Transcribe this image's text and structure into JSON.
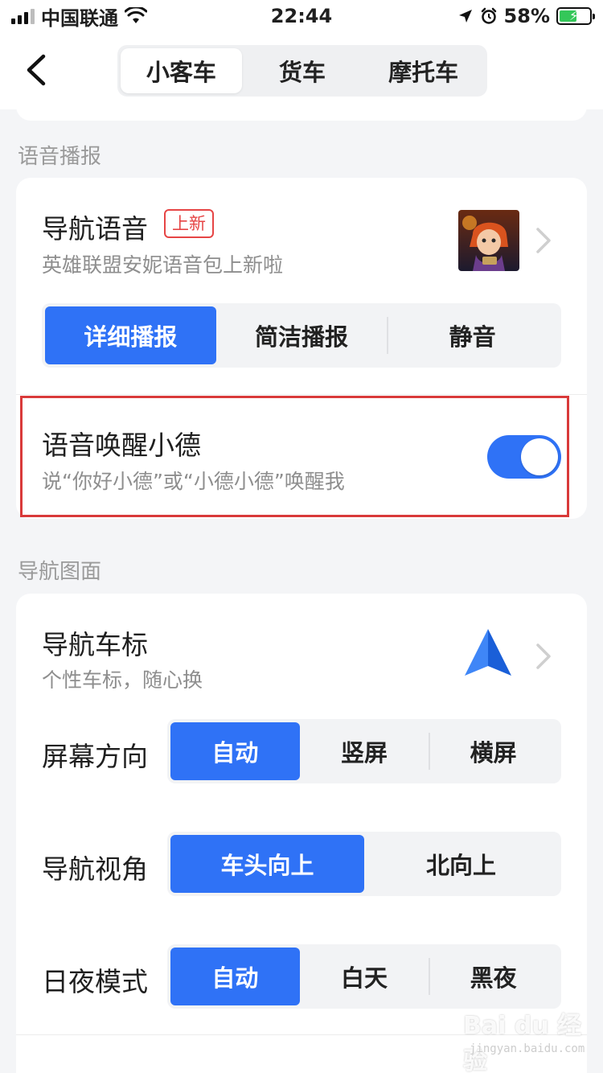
{
  "status_bar": {
    "carrier": "中国联通",
    "time": "22:44",
    "battery_percent": "58%",
    "battery_level": 0.58
  },
  "nav": {
    "tabs": [
      {
        "label": "小客车",
        "active": true
      },
      {
        "label": "货车",
        "active": false
      },
      {
        "label": "摩托车",
        "active": false
      }
    ]
  },
  "voice_section": {
    "title": "语音播报",
    "nav_voice": {
      "title": "导航语音",
      "badge": "上新",
      "subtitle": "英雄联盟安妮语音包上新啦",
      "options": [
        "详细播报",
        "简洁播报",
        "静音"
      ],
      "selected": "详细播报"
    },
    "wake": {
      "title": "语音唤醒小德",
      "subtitle": "说“你好小德”或“小德小德”唤醒我",
      "enabled": true
    }
  },
  "display_section": {
    "title": "导航图面",
    "car_icon": {
      "title": "导航车标",
      "subtitle": "个性车标，随心换"
    },
    "orientation": {
      "label": "屏幕方向",
      "options": [
        "自动",
        "竖屏",
        "横屏"
      ],
      "selected": "自动"
    },
    "view_angle": {
      "label": "导航视角",
      "options": [
        "车头向上",
        "北向上"
      ],
      "selected": "车头向上"
    },
    "day_night": {
      "label": "日夜模式",
      "options": [
        "自动",
        "白天",
        "黑夜"
      ],
      "selected": "自动"
    }
  },
  "watermark": {
    "text": "Bai du 经验",
    "sub": "jingyan.baidu.com"
  },
  "colors": {
    "accent": "#2f72f6",
    "badge": "#e64545",
    "highlight": "#d93a3a"
  }
}
